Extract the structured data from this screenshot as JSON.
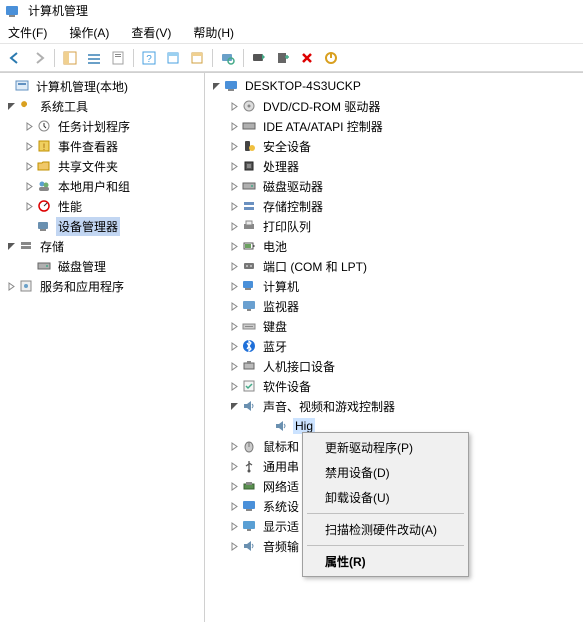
{
  "window": {
    "title": "计算机管理"
  },
  "menubar": {
    "file": "文件(F)",
    "action": "操作(A)",
    "view": "查看(V)",
    "help": "帮助(H)"
  },
  "left_tree": {
    "root": "计算机管理(本地)",
    "tools": "系统工具",
    "task": "任务计划程序",
    "event": "事件查看器",
    "shared": "共享文件夹",
    "users": "本地用户和组",
    "perf": "性能",
    "devmgr": "设备管理器",
    "storage": "存储",
    "disk": "磁盘管理",
    "services": "服务和应用程序"
  },
  "device_tree": {
    "computer": "DESKTOP-4S3UCKP",
    "dvd": "DVD/CD-ROM 驱动器",
    "ide": "IDE ATA/ATAPI 控制器",
    "security": "安全设备",
    "cpu": "处理器",
    "diskdrive": "磁盘驱动器",
    "storagectrl": "存储控制器",
    "printqueue": "打印队列",
    "battery": "电池",
    "ports": "端口 (COM 和 LPT)",
    "computers": "计算机",
    "monitor": "监视器",
    "keyboard": "键盘",
    "bluetooth": "蓝牙",
    "hid": "人机接口设备",
    "firmware": "软件设备",
    "sound": "声音、视频和游戏控制器",
    "sound_child": "High Definition Audio 设备",
    "mouse": "鼠标和其他指针设备",
    "usb_hub_prefix": "通用串行总线控制器",
    "network": "网络适配器",
    "sysdev": "系统设备",
    "display": "显示适配器",
    "audio_input": "音频输入和输出"
  },
  "context_menu": {
    "update": "更新驱动程序(P)",
    "disable": "禁用设备(D)",
    "uninstall": "卸载设备(U)",
    "scan": "扫描检测硬件改动(A)",
    "properties": "属性(R)"
  }
}
